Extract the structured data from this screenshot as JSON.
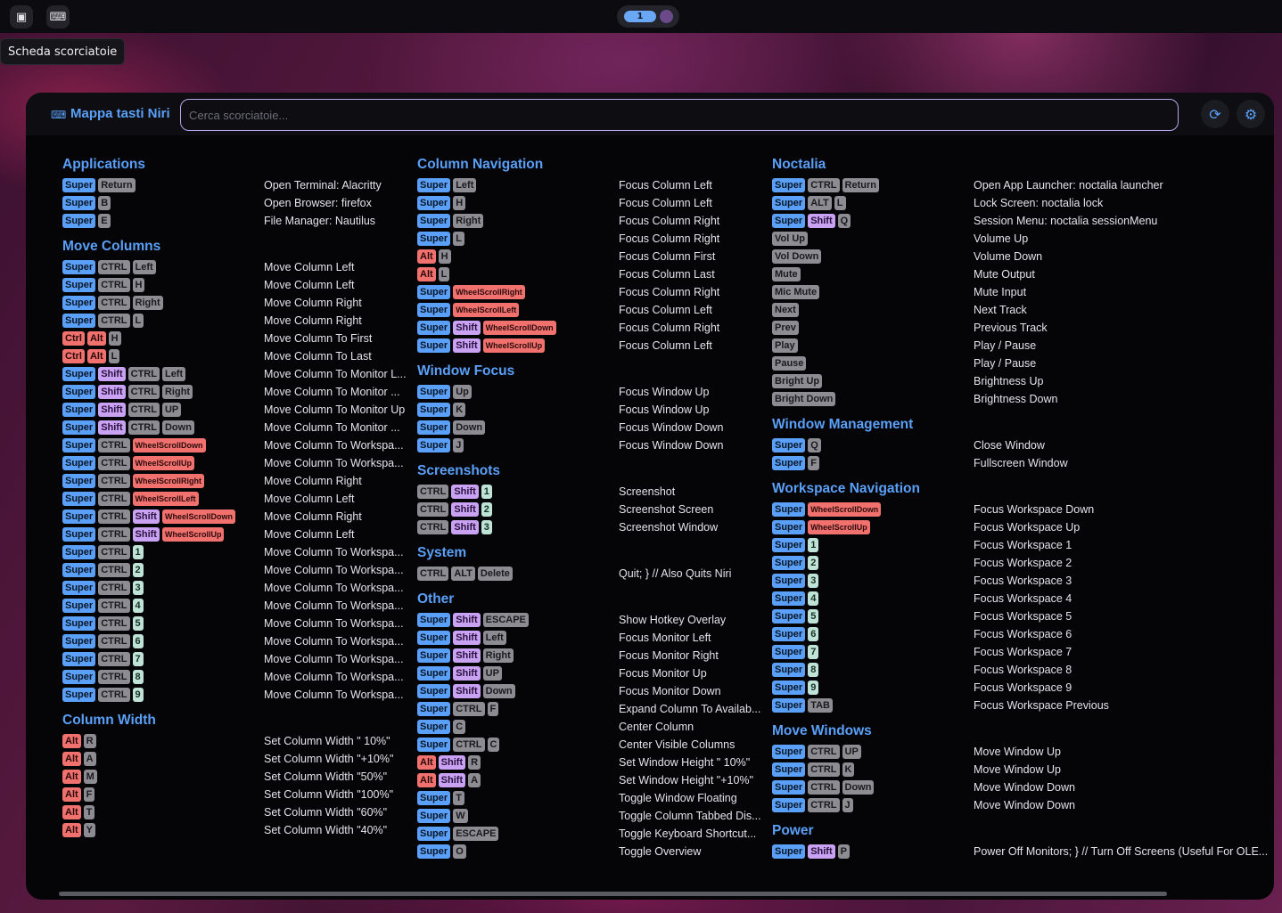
{
  "topbar": {
    "left_icons": [
      "chip-icon",
      "keyboard-icon"
    ],
    "workspace_active": "1",
    "tooltip": "Scheda scorciatoie"
  },
  "panel": {
    "title": "Mappa tasti Niri",
    "search_placeholder": "Cerca scorciatoie...",
    "buttons": [
      "refresh-icon",
      "settings-icon"
    ]
  },
  "colors": {
    "accent": "#5aa0f8",
    "key_super": "#5aa0f8",
    "key_modifier": "#8c8c92",
    "key_shift": "#c9a2f4",
    "key_alt": "#f0716e",
    "key_number": "#bfe3d6"
  },
  "columns": [
    [
      {
        "title": "Applications",
        "rows": [
          {
            "keys": [
              "Super",
              "Return"
            ],
            "desc": "Open Terminal: Alacritty"
          },
          {
            "keys": [
              "Super",
              "B"
            ],
            "desc": "Open Browser: firefox"
          },
          {
            "keys": [
              "Super",
              "E"
            ],
            "desc": "File Manager: Nautilus"
          }
        ]
      },
      {
        "title": "Move Columns",
        "rows": [
          {
            "keys": [
              "Super",
              "CTRL",
              "Left"
            ],
            "desc": "Move Column Left"
          },
          {
            "keys": [
              "Super",
              "CTRL",
              "H"
            ],
            "desc": "Move Column Left"
          },
          {
            "keys": [
              "Super",
              "CTRL",
              "Right"
            ],
            "desc": "Move Column Right"
          },
          {
            "keys": [
              "Super",
              "CTRL",
              "L"
            ],
            "desc": "Move Column Right"
          },
          {
            "keys": [
              "Ctrl",
              "Alt",
              "H"
            ],
            "desc": "Move Column To First"
          },
          {
            "keys": [
              "Ctrl",
              "Alt",
              "L"
            ],
            "desc": "Move Column To Last"
          },
          {
            "keys": [
              "Super",
              "Shift",
              "CTRL",
              "Left"
            ],
            "desc": "Move Column To Monitor L..."
          },
          {
            "keys": [
              "Super",
              "Shift",
              "CTRL",
              "Right"
            ],
            "desc": "Move Column To Monitor ..."
          },
          {
            "keys": [
              "Super",
              "Shift",
              "CTRL",
              "UP"
            ],
            "desc": "Move Column To Monitor Up"
          },
          {
            "keys": [
              "Super",
              "Shift",
              "CTRL",
              "Down"
            ],
            "desc": "Move Column To Monitor ..."
          },
          {
            "keys": [
              "Super",
              "CTRL",
              "WheelScrollDown"
            ],
            "desc": "Move Column To Workspa..."
          },
          {
            "keys": [
              "Super",
              "CTRL",
              "WheelScrollUp"
            ],
            "desc": "Move Column To Workspa..."
          },
          {
            "keys": [
              "Super",
              "CTRL",
              "WheelScrollRight"
            ],
            "desc": "Move Column Right"
          },
          {
            "keys": [
              "Super",
              "CTRL",
              "WheelScrollLeft"
            ],
            "desc": "Move Column Left"
          },
          {
            "keys": [
              "Super",
              "CTRL",
              "Shift",
              "WheelScrollDown"
            ],
            "desc": "Move Column Right"
          },
          {
            "keys": [
              "Super",
              "CTRL",
              "Shift",
              "WheelScrollUp"
            ],
            "desc": "Move Column Left"
          },
          {
            "keys": [
              "Super",
              "CTRL",
              "1"
            ],
            "desc": "Move Column To Workspa..."
          },
          {
            "keys": [
              "Super",
              "CTRL",
              "2"
            ],
            "desc": "Move Column To Workspa..."
          },
          {
            "keys": [
              "Super",
              "CTRL",
              "3"
            ],
            "desc": "Move Column To Workspa..."
          },
          {
            "keys": [
              "Super",
              "CTRL",
              "4"
            ],
            "desc": "Move Column To Workspa..."
          },
          {
            "keys": [
              "Super",
              "CTRL",
              "5"
            ],
            "desc": "Move Column To Workspa..."
          },
          {
            "keys": [
              "Super",
              "CTRL",
              "6"
            ],
            "desc": "Move Column To Workspa..."
          },
          {
            "keys": [
              "Super",
              "CTRL",
              "7"
            ],
            "desc": "Move Column To Workspa..."
          },
          {
            "keys": [
              "Super",
              "CTRL",
              "8"
            ],
            "desc": "Move Column To Workspa..."
          },
          {
            "keys": [
              "Super",
              "CTRL",
              "9"
            ],
            "desc": "Move Column To Workspa..."
          }
        ]
      },
      {
        "title": "Column Width",
        "rows": [
          {
            "keys": [
              "Alt",
              "R"
            ],
            "desc": "Set Column Width \" 10%\""
          },
          {
            "keys": [
              "Alt",
              "A"
            ],
            "desc": "Set Column Width \"+10%\""
          },
          {
            "keys": [
              "Alt",
              "M"
            ],
            "desc": "Set Column Width \"50%\""
          },
          {
            "keys": [
              "Alt",
              "F"
            ],
            "desc": "Set Column Width \"100%\""
          },
          {
            "keys": [
              "Alt",
              "T"
            ],
            "desc": "Set Column Width \"60%\""
          },
          {
            "keys": [
              "Alt",
              "Y"
            ],
            "desc": "Set Column Width \"40%\""
          }
        ]
      }
    ],
    [
      {
        "title": "Column Navigation",
        "rows": [
          {
            "keys": [
              "Super",
              "Left"
            ],
            "desc": "Focus Column Left"
          },
          {
            "keys": [
              "Super",
              "H"
            ],
            "desc": "Focus Column Left"
          },
          {
            "keys": [
              "Super",
              "Right"
            ],
            "desc": "Focus Column Right"
          },
          {
            "keys": [
              "Super",
              "L"
            ],
            "desc": "Focus Column Right"
          },
          {
            "keys": [
              "Alt",
              "H"
            ],
            "desc": "Focus Column First"
          },
          {
            "keys": [
              "Alt",
              "L"
            ],
            "desc": "Focus Column Last"
          },
          {
            "keys": [
              "Super",
              "WheelScrollRight"
            ],
            "desc": "Focus Column Right"
          },
          {
            "keys": [
              "Super",
              "WheelScrollLeft"
            ],
            "desc": "Focus Column Left"
          },
          {
            "keys": [
              "Super",
              "Shift",
              "WheelScrollDown"
            ],
            "desc": "Focus Column Right"
          },
          {
            "keys": [
              "Super",
              "Shift",
              "WheelScrollUp"
            ],
            "desc": "Focus Column Left"
          }
        ]
      },
      {
        "title": "Window Focus",
        "rows": [
          {
            "keys": [
              "Super",
              "Up"
            ],
            "desc": "Focus Window Up"
          },
          {
            "keys": [
              "Super",
              "K"
            ],
            "desc": "Focus Window Up"
          },
          {
            "keys": [
              "Super",
              "Down"
            ],
            "desc": "Focus Window Down"
          },
          {
            "keys": [
              "Super",
              "J"
            ],
            "desc": "Focus Window Down"
          }
        ]
      },
      {
        "title": "Screenshots",
        "rows": [
          {
            "keys": [
              "CTRL",
              "Shift",
              "1"
            ],
            "desc": "Screenshot"
          },
          {
            "keys": [
              "CTRL",
              "Shift",
              "2"
            ],
            "desc": "Screenshot Screen"
          },
          {
            "keys": [
              "CTRL",
              "Shift",
              "3"
            ],
            "desc": "Screenshot Window"
          }
        ]
      },
      {
        "title": "System",
        "rows": [
          {
            "keys": [
              "CTRL",
              "ALT",
              "Delete"
            ],
            "desc": "Quit; } // Also Quits Niri"
          }
        ]
      },
      {
        "title": "Other",
        "rows": [
          {
            "keys": [
              "Super",
              "Shift",
              "ESCAPE"
            ],
            "desc": "Show Hotkey Overlay"
          },
          {
            "keys": [
              "Super",
              "Shift",
              "Left"
            ],
            "desc": "Focus Monitor Left"
          },
          {
            "keys": [
              "Super",
              "Shift",
              "Right"
            ],
            "desc": "Focus Monitor Right"
          },
          {
            "keys": [
              "Super",
              "Shift",
              "UP"
            ],
            "desc": "Focus Monitor Up"
          },
          {
            "keys": [
              "Super",
              "Shift",
              "Down"
            ],
            "desc": "Focus Monitor Down"
          },
          {
            "keys": [
              "Super",
              "CTRL",
              "F"
            ],
            "desc": "Expand Column To Availab..."
          },
          {
            "keys": [
              "Super",
              "C"
            ],
            "desc": "Center Column"
          },
          {
            "keys": [
              "Super",
              "CTRL",
              "C"
            ],
            "desc": "Center Visible Columns"
          },
          {
            "keys": [
              "Alt",
              "Shift",
              "R"
            ],
            "desc": "Set Window Height \" 10%\""
          },
          {
            "keys": [
              "Alt",
              "Shift",
              "A"
            ],
            "desc": "Set Window Height \"+10%\""
          },
          {
            "keys": [
              "Super",
              "T"
            ],
            "desc": "Toggle Window Floating"
          },
          {
            "keys": [
              "Super",
              "W"
            ],
            "desc": "Toggle Column Tabbed Dis..."
          },
          {
            "keys": [
              "Super",
              "ESCAPE"
            ],
            "desc": "Toggle Keyboard Shortcut..."
          },
          {
            "keys": [
              "Super",
              "O"
            ],
            "desc": "Toggle Overview"
          }
        ]
      }
    ],
    [
      {
        "title": "Noctalia",
        "rows": [
          {
            "keys": [
              "Super",
              "CTRL",
              "Return"
            ],
            "desc": "Open App Launcher: noctalia launcher"
          },
          {
            "keys": [
              "Super",
              "ALT",
              "L"
            ],
            "desc": "Lock Screen: noctalia lock"
          },
          {
            "keys": [
              "Super",
              "Shift",
              "Q"
            ],
            "desc": "Session Menu: noctalia sessionMenu"
          },
          {
            "keys": [
              "Vol Up"
            ],
            "desc": "Volume Up"
          },
          {
            "keys": [
              "Vol Down"
            ],
            "desc": "Volume Down"
          },
          {
            "keys": [
              "Mute"
            ],
            "desc": "Mute Output"
          },
          {
            "keys": [
              "Mic Mute"
            ],
            "desc": "Mute Input"
          },
          {
            "keys": [
              "Next"
            ],
            "desc": "Next Track"
          },
          {
            "keys": [
              "Prev"
            ],
            "desc": "Previous Track"
          },
          {
            "keys": [
              "Play"
            ],
            "desc": "Play / Pause"
          },
          {
            "keys": [
              "Pause"
            ],
            "desc": "Play / Pause"
          },
          {
            "keys": [
              "Bright Up"
            ],
            "desc": "Brightness Up"
          },
          {
            "keys": [
              "Bright Down"
            ],
            "desc": "Brightness Down"
          }
        ]
      },
      {
        "title": "Window Management",
        "rows": [
          {
            "keys": [
              "Super",
              "Q"
            ],
            "desc": "Close Window"
          },
          {
            "keys": [
              "Super",
              "F"
            ],
            "desc": "Fullscreen Window"
          }
        ]
      },
      {
        "title": "Workspace Navigation",
        "rows": [
          {
            "keys": [
              "Super",
              "WheelScrollDown"
            ],
            "desc": "Focus Workspace Down"
          },
          {
            "keys": [
              "Super",
              "WheelScrollUp"
            ],
            "desc": "Focus Workspace Up"
          },
          {
            "keys": [
              "Super",
              "1"
            ],
            "desc": "Focus Workspace 1"
          },
          {
            "keys": [
              "Super",
              "2"
            ],
            "desc": "Focus Workspace 2"
          },
          {
            "keys": [
              "Super",
              "3"
            ],
            "desc": "Focus Workspace 3"
          },
          {
            "keys": [
              "Super",
              "4"
            ],
            "desc": "Focus Workspace 4"
          },
          {
            "keys": [
              "Super",
              "5"
            ],
            "desc": "Focus Workspace 5"
          },
          {
            "keys": [
              "Super",
              "6"
            ],
            "desc": "Focus Workspace 6"
          },
          {
            "keys": [
              "Super",
              "7"
            ],
            "desc": "Focus Workspace 7"
          },
          {
            "keys": [
              "Super",
              "8"
            ],
            "desc": "Focus Workspace 8"
          },
          {
            "keys": [
              "Super",
              "9"
            ],
            "desc": "Focus Workspace 9"
          },
          {
            "keys": [
              "Super",
              "TAB"
            ],
            "desc": "Focus Workspace Previous"
          }
        ]
      },
      {
        "title": "Move Windows",
        "rows": [
          {
            "keys": [
              "Super",
              "CTRL",
              "UP"
            ],
            "desc": "Move Window Up"
          },
          {
            "keys": [
              "Super",
              "CTRL",
              "K"
            ],
            "desc": "Move Window Up"
          },
          {
            "keys": [
              "Super",
              "CTRL",
              "Down"
            ],
            "desc": "Move Window Down"
          },
          {
            "keys": [
              "Super",
              "CTRL",
              "J"
            ],
            "desc": "Move Window Down"
          }
        ]
      },
      {
        "title": "Power",
        "rows": [
          {
            "keys": [
              "Super",
              "Shift",
              "P"
            ],
            "desc": "Power Off Monitors; } // Turn Off Screens (Useful For OLE..."
          }
        ]
      }
    ]
  ]
}
